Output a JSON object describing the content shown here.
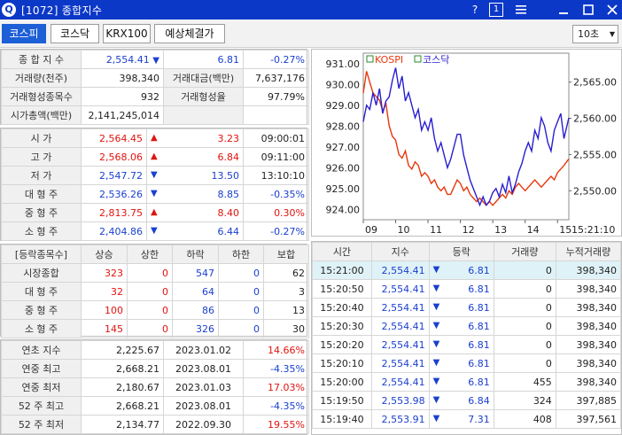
{
  "window": {
    "title": "[1072] 종합지수",
    "help": "?",
    "page": "1",
    "menu_icon": "list-icon",
    "minimize_icon": "minimize-icon",
    "maximize_icon": "maximize-icon",
    "close_icon": "close-icon"
  },
  "toolbar": {
    "tabs": [
      "코스피",
      "코스닥",
      "KRX100",
      "예상체결가"
    ],
    "interval": "10초"
  },
  "summary": {
    "index_label": "종 합 지 수",
    "index_value": "2,554.41",
    "index_change": "6.81",
    "index_rate": "-0.27%",
    "volume_label": "거래량(천주)",
    "volume_value": "398,340",
    "amount_label": "거래대금(백만)",
    "amount_value": "7,637,176",
    "traded_count_label": "거래형성종목수",
    "traded_count_value": "932",
    "traded_rate_label": "거래형성율",
    "traded_rate_value": "97.79%",
    "market_cap_label": "시가총액(백만)",
    "market_cap_value": "2,141,245,014"
  },
  "prices": [
    {
      "label": "시      가",
      "value": "2,564.45",
      "dir": "▲",
      "diff": "3.23",
      "extra": "09:00:01",
      "dir_class": "up",
      "extra_class": ""
    },
    {
      "label": "고      가",
      "value": "2,568.06",
      "dir": "▲",
      "diff": "6.84",
      "extra": "09:11:00",
      "dir_class": "up",
      "extra_class": ""
    },
    {
      "label": "저      가",
      "value": "2,547.72",
      "dir": "▼",
      "diff": "13.50",
      "extra": "13:10:10",
      "dir_class": "dn",
      "extra_class": ""
    },
    {
      "label": "대 형 주",
      "value": "2,536.26",
      "dir": "▼",
      "diff": "8.85",
      "extra": "-0.35%",
      "dir_class": "dn",
      "extra_class": "blue"
    },
    {
      "label": "중 형 주",
      "value": "2,813.75",
      "dir": "▲",
      "diff": "8.40",
      "extra": "0.30%",
      "dir_class": "up",
      "extra_class": "red"
    },
    {
      "label": "소 형 주",
      "value": "2,404.86",
      "dir": "▼",
      "diff": "6.44",
      "extra": "-0.27%",
      "dir_class": "dn",
      "extra_class": "blue"
    }
  ],
  "breadth": {
    "headers": [
      "[등락종목수]",
      "상승",
      "상한",
      "하락",
      "하한",
      "보합"
    ],
    "rows": [
      {
        "label": "시장종합",
        "up": "323",
        "upper": "0",
        "down": "547",
        "lower": "0",
        "flat": "62"
      },
      {
        "label": "대 형 주",
        "up": "32",
        "upper": "0",
        "down": "64",
        "lower": "0",
        "flat": "3"
      },
      {
        "label": "중 형 주",
        "up": "100",
        "upper": "0",
        "down": "86",
        "lower": "0",
        "flat": "13"
      },
      {
        "label": "소 형 주",
        "up": "145",
        "upper": "0",
        "down": "326",
        "lower": "0",
        "flat": "30"
      }
    ]
  },
  "yearly": [
    {
      "label": "연초  지수",
      "value": "2,225.67",
      "date": "2023.01.02",
      "rate": "14.66%",
      "rate_class": "red"
    },
    {
      "label": "연중  최고",
      "value": "2,668.21",
      "date": "2023.08.01",
      "rate": "-4.35%",
      "rate_class": "blue"
    },
    {
      "label": "연중  최저",
      "value": "2,180.67",
      "date": "2023.01.03",
      "rate": "17.03%",
      "rate_class": "red"
    },
    {
      "label": "52 주 최고",
      "value": "2,668.21",
      "date": "2023.08.01",
      "rate": "-4.35%",
      "rate_class": "blue"
    },
    {
      "label": "52 주 최저",
      "value": "2,134.77",
      "date": "2022.09.30",
      "rate": "19.55%",
      "rate_class": "red"
    }
  ],
  "ticks": {
    "headers": [
      "시간",
      "지수",
      "등락",
      "거래량",
      "누적거래량"
    ],
    "rows": [
      {
        "time": "15:21:00",
        "index": "2,554.41",
        "dir": "▼",
        "change": "6.81",
        "vol": "0",
        "cum": "398,340"
      },
      {
        "time": "15:20:50",
        "index": "2,554.41",
        "dir": "▼",
        "change": "6.81",
        "vol": "0",
        "cum": "398,340"
      },
      {
        "time": "15:20:40",
        "index": "2,554.41",
        "dir": "▼",
        "change": "6.81",
        "vol": "0",
        "cum": "398,340"
      },
      {
        "time": "15:20:30",
        "index": "2,554.41",
        "dir": "▼",
        "change": "6.81",
        "vol": "0",
        "cum": "398,340"
      },
      {
        "time": "15:20:20",
        "index": "2,554.41",
        "dir": "▼",
        "change": "6.81",
        "vol": "0",
        "cum": "398,340"
      },
      {
        "time": "15:20:10",
        "index": "2,554.41",
        "dir": "▼",
        "change": "6.81",
        "vol": "0",
        "cum": "398,340"
      },
      {
        "time": "15:20:00",
        "index": "2,554.41",
        "dir": "▼",
        "change": "6.81",
        "vol": "455",
        "cum": "398,340"
      },
      {
        "time": "15:19:50",
        "index": "2,553.98",
        "dir": "▼",
        "change": "6.84",
        "vol": "324",
        "cum": "397,885"
      },
      {
        "time": "15:19:40",
        "index": "2,553.91",
        "dir": "▼",
        "change": "7.31",
        "vol": "408",
        "cum": "397,561"
      }
    ]
  },
  "chart_data": {
    "type": "line",
    "legend": [
      "KOSPI",
      "코스닥"
    ],
    "left_axis_ticks": [
      "931.00",
      "930.00",
      "929.00",
      "928.00",
      "927.00",
      "926.00",
      "925.00",
      "924.00"
    ],
    "right_axis_ticks": [
      "2,565.00",
      "2,560.00",
      "2,555.00",
      "2,550.00"
    ],
    "x_ticks": [
      "09",
      "10",
      "11",
      "12",
      "13",
      "14",
      "15",
      "15:21:10"
    ],
    "ylim_left": [
      923.5,
      931.5
    ],
    "ylim_right": [
      2546,
      2569
    ],
    "series": [
      {
        "name": "KOSPI",
        "axis": "right",
        "color": "#e8380c",
        "x": [
          9.0,
          9.1,
          9.2,
          9.3,
          9.4,
          9.5,
          9.6,
          9.7,
          9.8,
          9.9,
          10.0,
          10.1,
          10.2,
          10.3,
          10.4,
          10.5,
          10.6,
          10.7,
          10.8,
          10.9,
          11.0,
          11.1,
          11.2,
          11.3,
          11.4,
          11.5,
          11.6,
          11.7,
          11.8,
          11.9,
          12.0,
          12.1,
          12.2,
          12.3,
          12.4,
          12.5,
          12.6,
          12.7,
          12.8,
          12.9,
          13.0,
          13.1,
          13.2,
          13.3,
          13.4,
          13.5,
          13.6,
          13.7,
          13.8,
          13.9,
          14.0,
          14.1,
          14.2,
          14.3,
          14.4,
          14.5,
          14.6,
          14.7,
          14.8,
          14.9,
          15.0,
          15.1,
          15.2,
          15.35
        ],
        "values": [
          2563.5,
          2566.5,
          2565.0,
          2563.5,
          2563.0,
          2562.5,
          2561.0,
          2562.0,
          2559.0,
          2557.5,
          2557.0,
          2555.0,
          2554.5,
          2555.5,
          2553.5,
          2553.0,
          2554.0,
          2553.5,
          2552.0,
          2552.5,
          2552.0,
          2551.0,
          2551.5,
          2550.5,
          2550.0,
          2550.5,
          2549.5,
          2549.5,
          2550.5,
          2551.5,
          2551.0,
          2550.0,
          2550.5,
          2549.5,
          2549.0,
          2548.5,
          2549.0,
          2548.5,
          2548.0,
          2548.5,
          2548.0,
          2548.5,
          2549.0,
          2549.5,
          2549.0,
          2550.0,
          2549.5,
          2550.5,
          2551.0,
          2550.5,
          2550.0,
          2550.5,
          2551.0,
          2551.5,
          2551.0,
          2550.5,
          2551.0,
          2551.5,
          2552.0,
          2551.5,
          2552.5,
          2553.0,
          2553.5,
          2554.4
        ]
      },
      {
        "name": "코스닥",
        "axis": "left",
        "color": "#2a1fd0",
        "x": [
          9.0,
          9.1,
          9.2,
          9.3,
          9.4,
          9.5,
          9.6,
          9.7,
          9.8,
          9.9,
          10.0,
          10.1,
          10.2,
          10.3,
          10.4,
          10.5,
          10.6,
          10.7,
          10.8,
          10.9,
          11.0,
          11.1,
          11.2,
          11.3,
          11.4,
          11.5,
          11.6,
          11.7,
          11.8,
          11.9,
          12.0,
          12.1,
          12.2,
          12.3,
          12.4,
          12.5,
          12.6,
          12.7,
          12.8,
          12.9,
          13.0,
          13.1,
          13.2,
          13.3,
          13.4,
          13.5,
          13.6,
          13.7,
          13.8,
          13.9,
          14.0,
          14.1,
          14.2,
          14.3,
          14.4,
          14.5,
          14.6,
          14.7,
          14.8,
          14.9,
          15.0,
          15.1,
          15.2,
          15.35
        ],
        "values": [
          928.2,
          929.0,
          928.8,
          929.6,
          929.0,
          929.8,
          928.6,
          929.2,
          929.4,
          930.2,
          930.8,
          929.8,
          930.4,
          929.2,
          929.6,
          929.0,
          928.4,
          928.8,
          927.8,
          928.2,
          927.8,
          928.4,
          927.4,
          926.8,
          927.2,
          926.6,
          926.0,
          926.4,
          927.0,
          927.6,
          927.6,
          926.6,
          926.0,
          925.4,
          925.0,
          924.6,
          924.2,
          924.6,
          924.2,
          924.4,
          924.8,
          925.0,
          924.6,
          925.2,
          924.8,
          925.6,
          924.8,
          925.2,
          925.8,
          926.2,
          926.8,
          927.2,
          926.8,
          927.8,
          927.4,
          928.4,
          928.0,
          927.2,
          926.8,
          927.8,
          928.2,
          928.6,
          927.4,
          928.4
        ]
      }
    ]
  }
}
